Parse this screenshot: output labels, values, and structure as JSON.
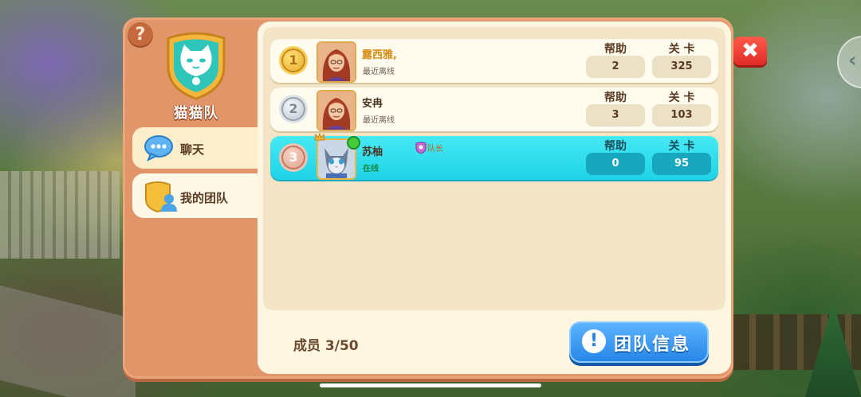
{
  "team": {
    "name": "猫猫队",
    "help_icon": "?"
  },
  "sidebar": {
    "items": [
      {
        "label": "聊天",
        "icon": "chat-bubble-icon"
      },
      {
        "label": "我的团队",
        "icon": "team-members-icon"
      }
    ]
  },
  "members": {
    "columns": {
      "help": "帮助",
      "level": "关 卡"
    },
    "rows": [
      {
        "rank": "1",
        "name": "露西雅,",
        "status": "最近离线",
        "help": "2",
        "level": "325"
      },
      {
        "rank": "2",
        "name": "安冉",
        "status": "最近离线",
        "help": "3",
        "level": "103"
      },
      {
        "rank": "3",
        "name": "苏柚",
        "status": "在线",
        "badge": "队长",
        "help": "0",
        "level": "95"
      }
    ]
  },
  "footer": {
    "members_count": "成员 3/50",
    "team_info_label": "团队信息",
    "info_icon": "!"
  },
  "close_icon": "✖",
  "side_arrow_icon": "‹",
  "colors": {
    "panel": "#e3956a",
    "content": "#fff6e2",
    "highlight_row": "#1fd3e6",
    "button_blue": "#2484e8",
    "close_red": "#e02c28"
  }
}
